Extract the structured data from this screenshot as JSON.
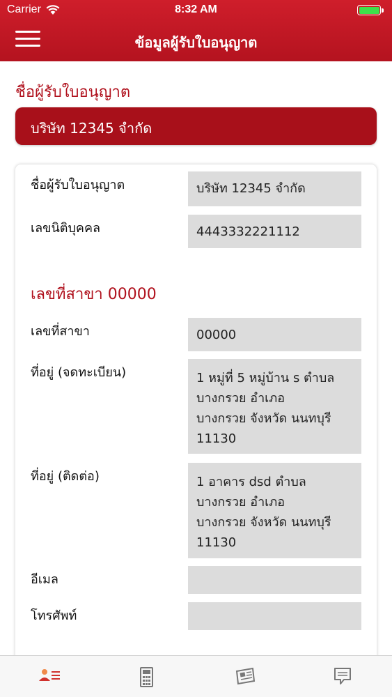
{
  "status_bar": {
    "carrier": "Carrier",
    "time": "8:32 AM",
    "battery_color": "#3ee04a"
  },
  "nav": {
    "title": "ข้อมูลผู้รับใบอนุญาต",
    "menu_icon": "hamburger-menu-icon"
  },
  "licensee": {
    "section_title": "ชื่อผู้รับใบอนุญาต",
    "banner_name": "บริษัท 12345 จำกัด"
  },
  "details": {
    "name_label": "ชื่อผู้รับใบอนุญาต",
    "name_value": "บริษัท 12345 จำกัด",
    "juristic_label": "เลขนิติบุคคล",
    "juristic_value": "4443332221112",
    "branch_title": "เลขที่สาขา 00000",
    "branch_label": "เลขที่สาขา",
    "branch_value": "00000",
    "reg_address_label": "ที่อยู่ (จดทะเบียน)",
    "reg_address_lines": [
      "1 หมู่ที่ 5 หมู่บ้าน s ตำบล",
      "บางกรวย อำเภอ",
      "บางกรวย จังหวัด นนทบุรี",
      "11130"
    ],
    "contact_address_label": "ที่อยู่ (ติดต่อ)",
    "contact_address_lines": [
      "1 อาคาร dsd ตำบล",
      "บางกรวย อำเภอ",
      "บางกรวย จังหวัด นนทบุรี",
      "11130"
    ],
    "email_label": "อีเมล",
    "email_value": "",
    "phone_label": "โทรศัพท์",
    "phone_value": ""
  },
  "tabs": [
    {
      "icon": "person-list-icon",
      "active": true
    },
    {
      "icon": "calculator-icon",
      "active": false
    },
    {
      "icon": "newspaper-icon",
      "active": false
    },
    {
      "icon": "chat-bubble-icon",
      "active": false
    }
  ],
  "colors": {
    "brand_red": "#c4192a",
    "banner_red": "#a8101a",
    "field_gray": "#dcdcdc"
  }
}
